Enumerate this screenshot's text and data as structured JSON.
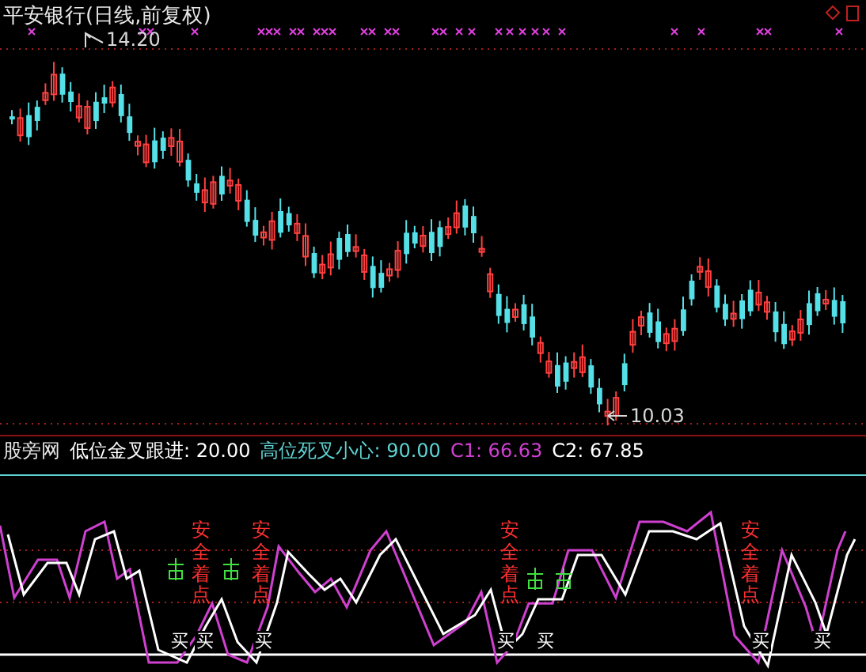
{
  "chart_title": "平安银行(日线,前复权)",
  "price_labels": {
    "high": "14.20",
    "low": "10.03"
  },
  "indicator": {
    "name": "股旁网",
    "items": [
      {
        "label": "低位金叉跟进: 20.00",
        "color": "#ffffff"
      },
      {
        "label": "高位死叉小心: 90.00",
        "color": "#5fd3d3"
      },
      {
        "label": "C1: 66.63",
        "color": "#d040d0"
      },
      {
        "label": "C2: 67.85",
        "color": "#ffffff"
      }
    ]
  },
  "safe_points": [
    {
      "text": "安全着点"
    },
    {
      "text": "安全着点"
    },
    {
      "text": "安全着点"
    },
    {
      "text": "安全着点"
    }
  ],
  "buy_labels": [
    {
      "text": "买"
    },
    {
      "text": "买"
    },
    {
      "text": "买"
    },
    {
      "text": "买"
    },
    {
      "text": "买"
    },
    {
      "text": "买"
    },
    {
      "text": "买"
    }
  ]
}
